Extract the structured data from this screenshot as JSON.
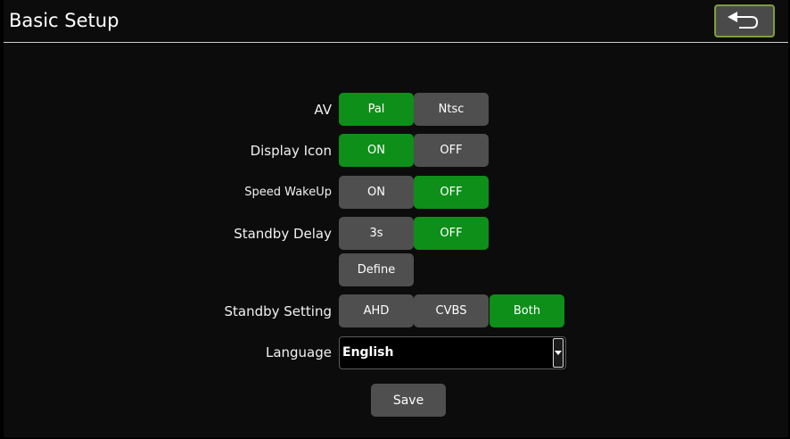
{
  "header": {
    "title": "Basic Setup",
    "back_icon": "back-arrow-icon"
  },
  "settings": {
    "av": {
      "label": "AV",
      "options": [
        "Pal",
        "Ntsc"
      ],
      "selected": "Pal"
    },
    "display_icon": {
      "label": "Display Icon",
      "options": [
        "ON",
        "OFF"
      ],
      "selected": "ON"
    },
    "speed_wakeup": {
      "label": "Speed WakeUp",
      "options": [
        "ON",
        "OFF"
      ],
      "selected": "OFF"
    },
    "standby_delay": {
      "label": "Standby Delay",
      "options": [
        "3s",
        "OFF",
        "Define"
      ],
      "selected": "OFF"
    },
    "standby_setting": {
      "label": "Standby Setting",
      "options": [
        "AHD",
        "CVBS",
        "Both"
      ],
      "selected": "Both"
    },
    "language": {
      "label": "Language",
      "value": "English"
    }
  },
  "actions": {
    "save_label": "Save"
  },
  "colors": {
    "selected": "#0e8f1a",
    "unselected": "#4f4f4f",
    "back_border": "#7e9f3a"
  }
}
